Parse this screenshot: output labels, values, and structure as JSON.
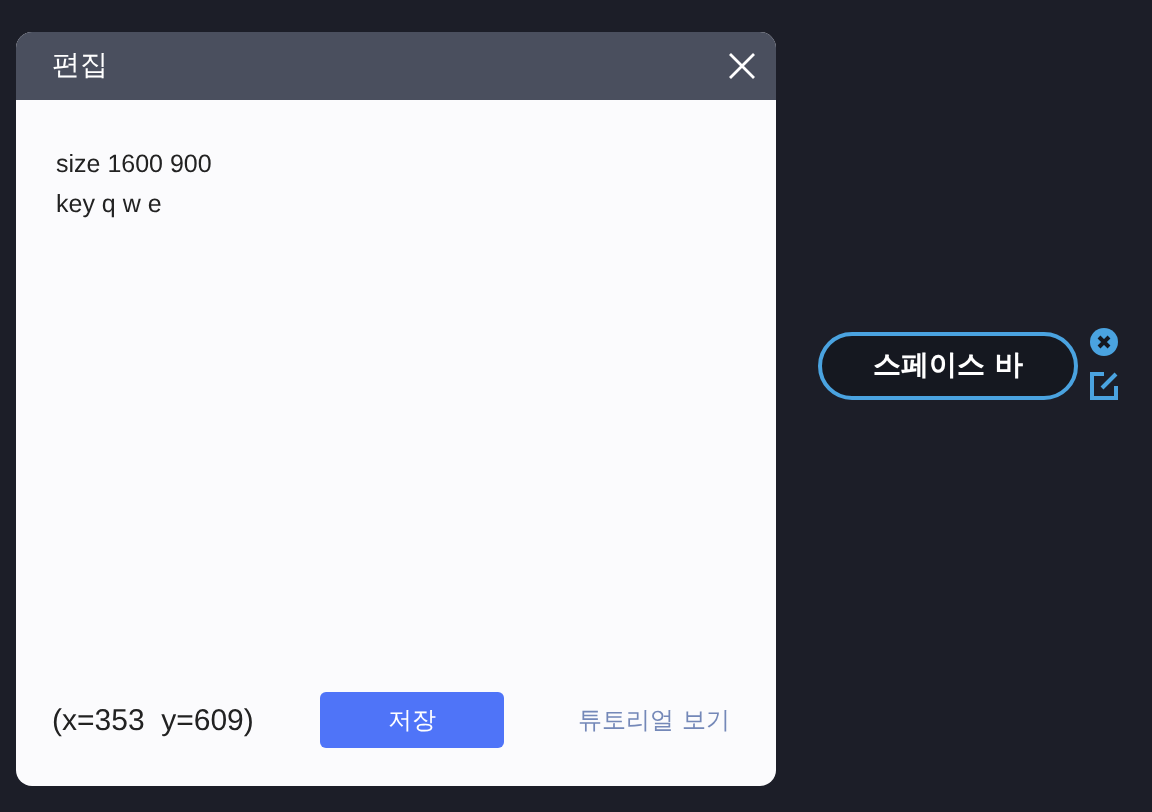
{
  "dialog": {
    "title": "편집",
    "editor": {
      "lines": [
        "size 1600 900",
        "key q w e"
      ]
    },
    "coordinates": "(x=353  y=609)",
    "save_button": "저장",
    "tutorial_link": "튜토리얼 보기"
  },
  "key_overlay": {
    "label": "스페이스 바"
  }
}
